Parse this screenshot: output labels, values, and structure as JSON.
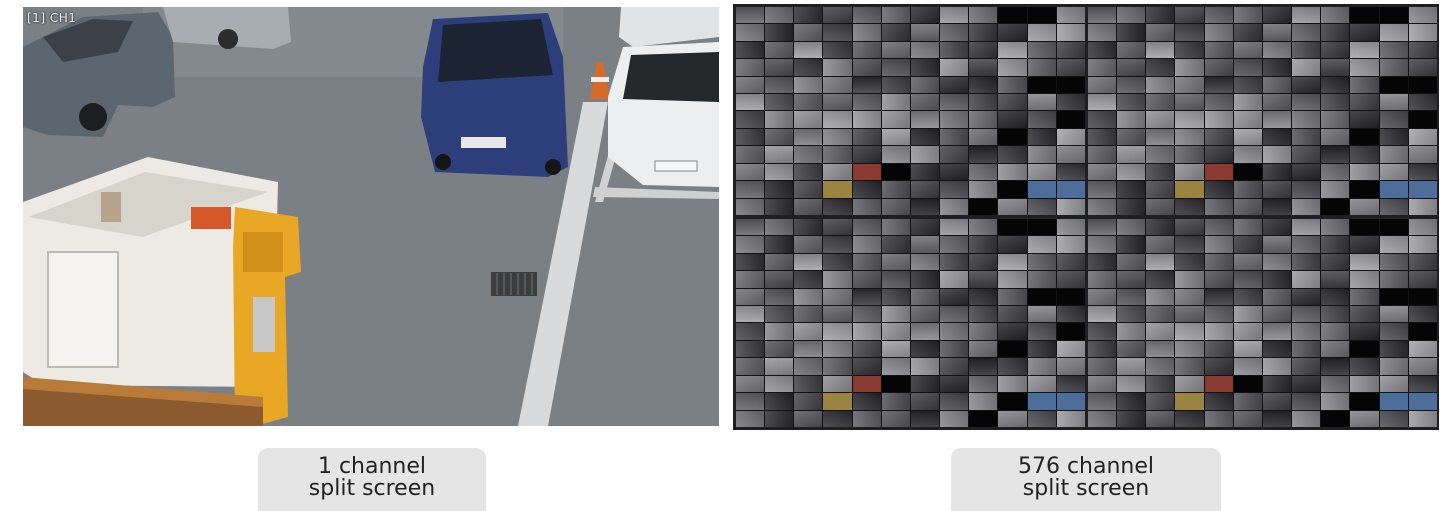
{
  "single_view": {
    "channel_label": "[1] CH1"
  },
  "multi_view": {
    "quadrants": 4,
    "grid_columns": 12,
    "grid_rows": 12
  },
  "captions": {
    "left": {
      "line1": "1 channel",
      "line2": "split screen"
    },
    "right": {
      "line1": "576 channel",
      "line2": "split screen"
    }
  },
  "colors": {
    "caption_bg": "#e5e5e5",
    "multi_view_frame": "#1d1f22",
    "cell_black": "#050505",
    "cell_red": "#8a3a30",
    "cell_blue": "#4d6d9a",
    "cell_yellow": "#9a8440"
  }
}
